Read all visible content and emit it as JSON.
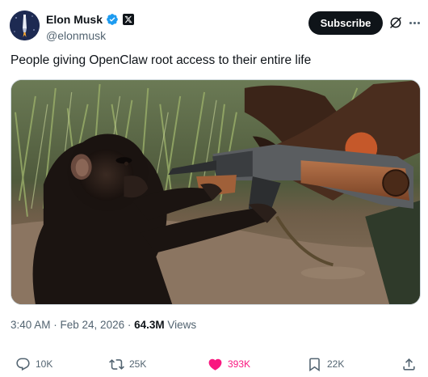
{
  "author": {
    "display_name": "Elon Musk",
    "handle": "@elonmusk",
    "avatar_icon": "rocket-avatar",
    "verified_color": "#1d9bf0"
  },
  "header": {
    "subscribe_label": "Subscribe",
    "grok_icon": "grok-icon",
    "more_icon": "more-icon"
  },
  "tweet": {
    "text": "People giving OpenClaw root access to their entire life"
  },
  "meta": {
    "time": "3:40 AM",
    "separator": " · ",
    "date": "Feb 24, 2026",
    "separator2": " · ",
    "views_count": "64.3M",
    "views_label": " Views"
  },
  "actions": {
    "reply": {
      "icon": "reply-icon",
      "count": "10K"
    },
    "repost": {
      "icon": "repost-icon",
      "count": "25K"
    },
    "like": {
      "icon": "heart-icon",
      "count": "393K",
      "liked": true,
      "color": "#f91880"
    },
    "bookmark": {
      "icon": "bookmark-icon",
      "count": "22K"
    },
    "share": {
      "icon": "share-icon"
    }
  }
}
